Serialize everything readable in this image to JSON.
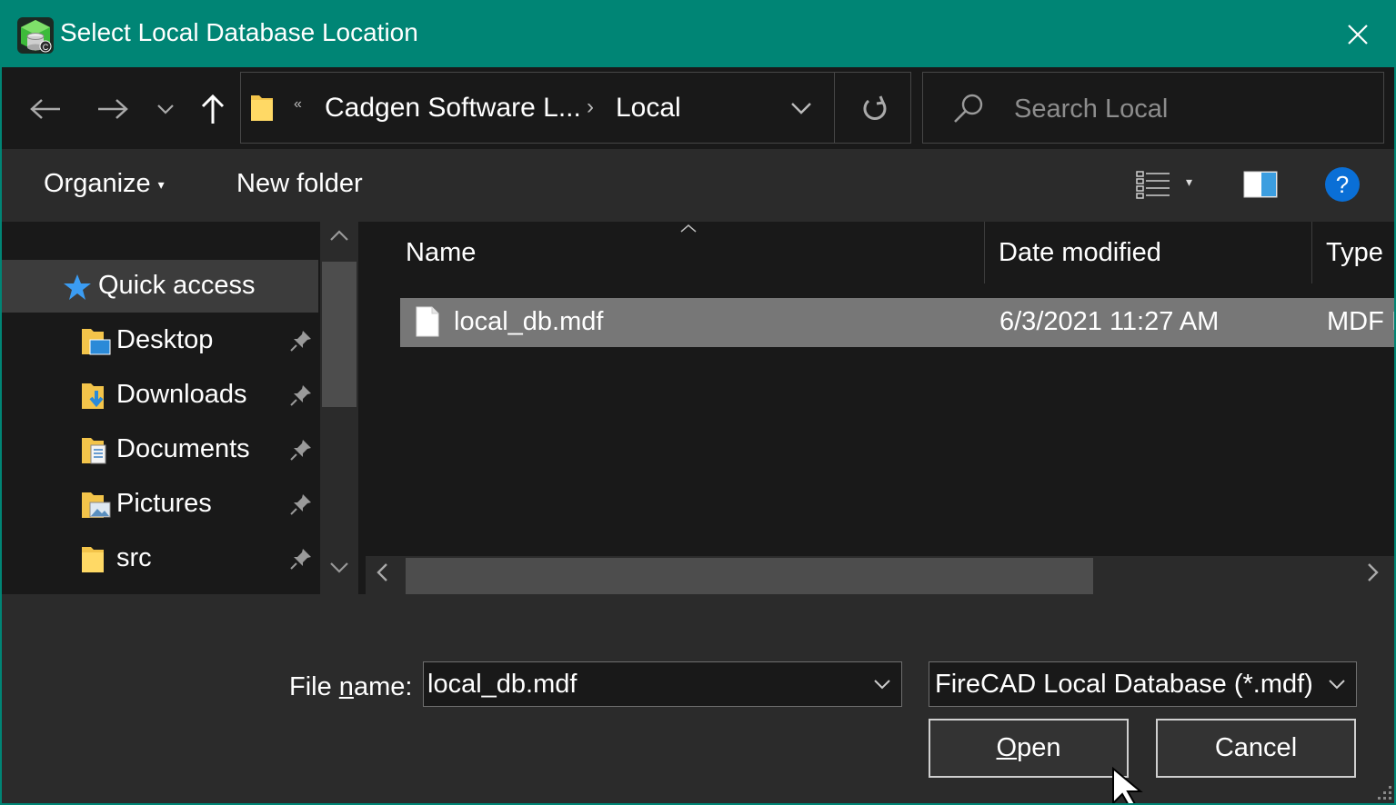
{
  "window": {
    "title": "Select Local Database Location",
    "app_icon": "database-app-icon",
    "close_icon": "close-icon"
  },
  "nav": {
    "back_icon": "arrow-left-icon",
    "forward_icon": "arrow-right-icon",
    "recent_icon": "chevron-down-icon",
    "up_icon": "arrow-up-icon",
    "address": {
      "overflow_marker": "«",
      "crumbs": [
        "Cadgen Software L...",
        "Local"
      ],
      "separator": "›"
    },
    "refresh_icon": "refresh-icon",
    "search": {
      "placeholder": "Search Local"
    }
  },
  "toolbar": {
    "organize_label": "Organize",
    "new_folder_label": "New folder",
    "view_icon": "details-view-icon",
    "preview_icon": "preview-pane-icon",
    "help_label": "?"
  },
  "sidebar": {
    "items": [
      {
        "label": "Quick access",
        "icon": "star-icon",
        "pinned": false,
        "selected": true
      },
      {
        "label": "Desktop",
        "icon": "desktop-folder-icon",
        "pinned": true
      },
      {
        "label": "Downloads",
        "icon": "downloads-folder-icon",
        "pinned": true
      },
      {
        "label": "Documents",
        "icon": "documents-folder-icon",
        "pinned": true
      },
      {
        "label": "Pictures",
        "icon": "pictures-folder-icon",
        "pinned": true
      },
      {
        "label": "src",
        "icon": "folder-icon",
        "pinned": true
      }
    ]
  },
  "file_list": {
    "columns": [
      "Name",
      "Date modified",
      "Type"
    ],
    "rows": [
      {
        "name": "local_db.mdf",
        "date_modified": "6/3/2021 11:27 AM",
        "type": "MDF I",
        "selected": true
      }
    ]
  },
  "footer": {
    "file_name_label_pre": "File ",
    "file_name_label_mnemonic": "n",
    "file_name_label_post": "ame:",
    "file_name_value": "local_db.mdf",
    "filter_value": "FireCAD Local Database (*.mdf)",
    "open_label_mnemonic": "O",
    "open_label_rest": "pen",
    "cancel_label": "Cancel"
  },
  "colors": {
    "titlebar": "#008575",
    "background": "#191919",
    "panel": "#2b2b2b",
    "selected_row": "#777777",
    "help_blue": "#0a6fd6"
  }
}
